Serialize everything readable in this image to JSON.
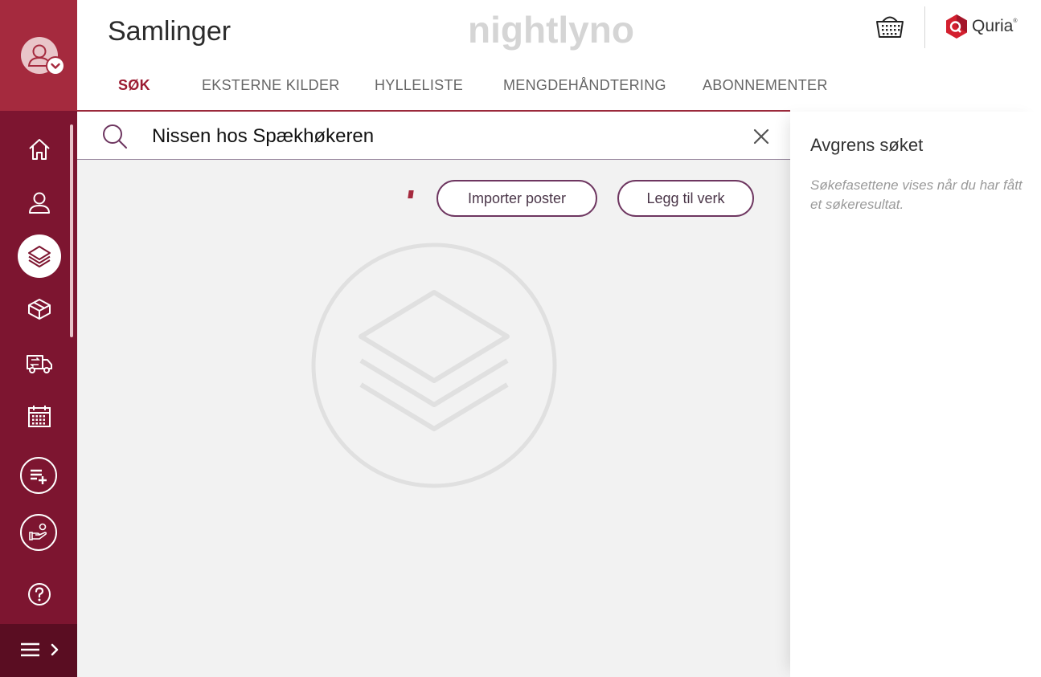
{
  "header": {
    "title": "Samlinger",
    "brand": "nightlyno",
    "logo_text": "Quria",
    "logo_mark": "®"
  },
  "tabs": [
    {
      "label": "SØK",
      "active": true
    },
    {
      "label": "EKSTERNE KILDER",
      "active": false
    },
    {
      "label": "HYLLELISTE",
      "active": false
    },
    {
      "label": "MENGDEHÅNDTERING",
      "active": false
    },
    {
      "label": "ABONNEMENTER",
      "active": false
    }
  ],
  "search": {
    "value": "Nissen hos Spækhøkeren"
  },
  "actions": {
    "import_label": "Importer poster",
    "add_work_label": "Legg til verk"
  },
  "facets": {
    "title": "Avgrens søket",
    "hint": "Søkefasettene vises når du har fått et søkeresultat."
  },
  "sidebar": {
    "items": [
      {
        "icon": "home-icon"
      },
      {
        "icon": "user-icon"
      },
      {
        "icon": "layers-icon",
        "active": true
      },
      {
        "icon": "package-icon"
      },
      {
        "icon": "truck-icon"
      },
      {
        "icon": "calendar-icon"
      },
      {
        "icon": "add-list-icon"
      },
      {
        "icon": "hand-icon"
      },
      {
        "icon": "help-icon"
      },
      {
        "icon": "menu-icon"
      }
    ]
  },
  "colors": {
    "sidebar": "#7d1530",
    "sidebar_top": "#a52a3e",
    "accent": "#9b1c32",
    "button_border": "#6e3660"
  }
}
